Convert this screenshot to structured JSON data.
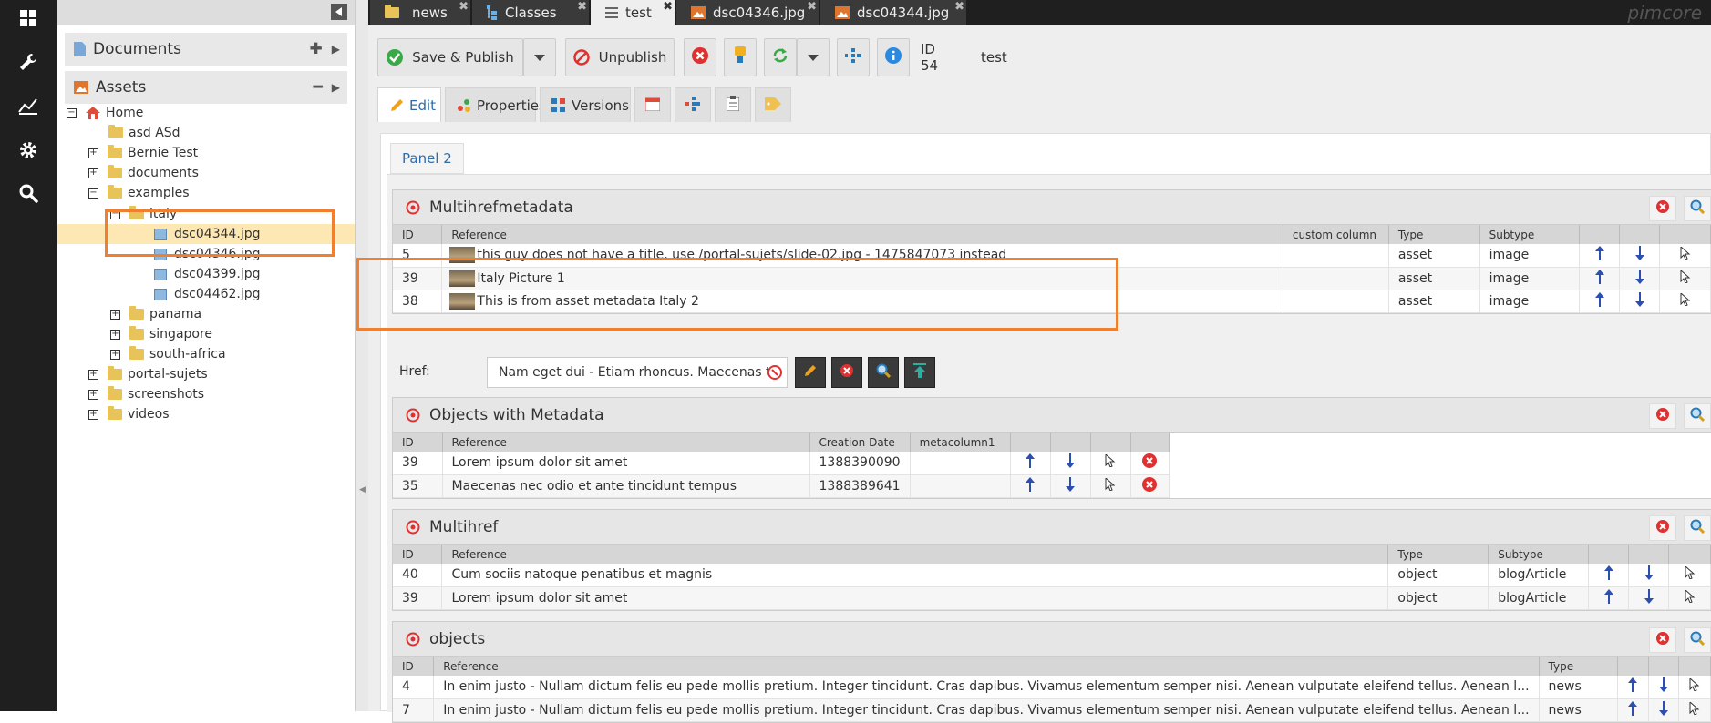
{
  "tree": {
    "documents_label": "Documents",
    "assets_label": "Assets",
    "nodes": [
      {
        "label": "Home"
      },
      {
        "label": "asd ASd"
      },
      {
        "label": "Bernie Test"
      },
      {
        "label": "documents"
      },
      {
        "label": "examples"
      },
      {
        "label": "italy"
      },
      {
        "label": "dsc04344.jpg"
      },
      {
        "label": "dsc04346.jpg"
      },
      {
        "label": "dsc04399.jpg"
      },
      {
        "label": "dsc04462.jpg"
      },
      {
        "label": "panama"
      },
      {
        "label": "singapore"
      },
      {
        "label": "south-africa"
      },
      {
        "label": "portal-sujets"
      },
      {
        "label": "screenshots"
      },
      {
        "label": "videos"
      }
    ]
  },
  "tabs": [
    {
      "label": "news"
    },
    {
      "label": "Classes"
    },
    {
      "label": "test"
    },
    {
      "label": "dsc04346.jpg"
    },
    {
      "label": "dsc04344.jpg"
    }
  ],
  "brand": "pimcore",
  "toolbar": {
    "save_publish": "Save & Publish",
    "unpublish": "Unpublish",
    "id_label": "ID 54",
    "name": "test"
  },
  "subtabs": {
    "edit": "Edit",
    "properties": "Properties",
    "versions": "Versions"
  },
  "panel_tab": "Panel 2",
  "multihrefmetadata": {
    "title": "Multihrefmetadata",
    "columns": [
      "ID",
      "Reference",
      "custom column",
      "Type",
      "Subtype"
    ],
    "rows": [
      {
        "id": "5",
        "reference": "this guy does not have a title, use /portal-sujets/slide-02.jpg - 1475847073 instead",
        "custom": "",
        "type": "asset",
        "subtype": "image"
      },
      {
        "id": "39",
        "reference": "Italy Picture 1",
        "custom": "",
        "type": "asset",
        "subtype": "image"
      },
      {
        "id": "38",
        "reference": "This is from asset metadata Italy 2",
        "custom": "",
        "type": "asset",
        "subtype": "image"
      }
    ]
  },
  "href": {
    "label": "Href:",
    "value": "Nam eget dui - Etiam rhoncus. Maecenas tem"
  },
  "objects_metadata": {
    "title": "Objects with Metadata",
    "columns": [
      "ID",
      "Reference",
      "Creation Date",
      "metacolumn1"
    ],
    "rows": [
      {
        "id": "39",
        "reference": "Lorem ipsum dolor sit amet",
        "date": "1388390090",
        "meta": ""
      },
      {
        "id": "35",
        "reference": "Maecenas nec odio et ante tincidunt tempus",
        "date": "1388389641",
        "meta": ""
      }
    ]
  },
  "multihref": {
    "title": "Multihref",
    "columns": [
      "ID",
      "Reference",
      "Type",
      "Subtype"
    ],
    "rows": [
      {
        "id": "40",
        "reference": "Cum sociis natoque penatibus et magnis",
        "type": "object",
        "subtype": "blogArticle"
      },
      {
        "id": "39",
        "reference": "Lorem ipsum dolor sit amet",
        "type": "object",
        "subtype": "blogArticle"
      }
    ]
  },
  "objects": {
    "title": "objects",
    "columns": [
      "ID",
      "Reference",
      "Type"
    ],
    "rows": [
      {
        "id": "4",
        "reference": "In enim justo - Nullam dictum felis eu pede mollis pretium. Integer tincidunt. Cras dapibus. Vivamus elementum semper nisi. Aenean vulputate eleifend tellus. Aenean l...",
        "type": "news"
      },
      {
        "id": "7",
        "reference": "In enim justo - Nullam dictum felis eu pede mollis pretium. Integer tincidunt. Cras dapibus. Vivamus elementum semper nisi. Aenean vulputate eleifend tellus. Aenean l...",
        "type": "news"
      }
    ]
  },
  "colors": {
    "highlight": "#f08030",
    "selected_row": "#fde7b3",
    "link_blue": "#2f6ca8",
    "delete_red": "#e03030",
    "arrow_blue": "#2a4fb0"
  }
}
